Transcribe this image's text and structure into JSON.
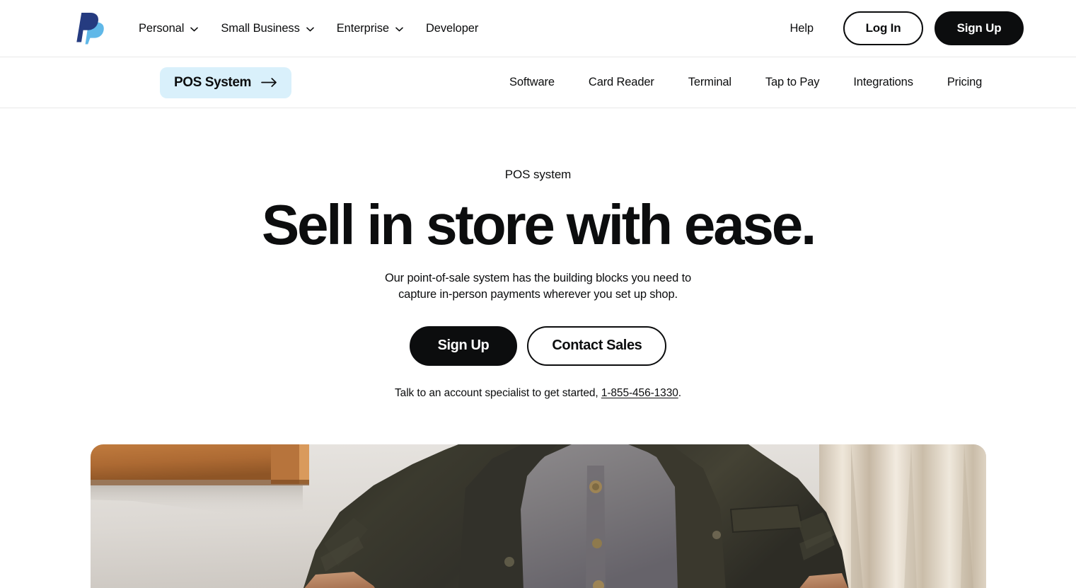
{
  "topnav": {
    "logo_icon": "paypal-logo-icon",
    "links": [
      {
        "label": "Personal",
        "has_chevron": true
      },
      {
        "label": "Small Business",
        "has_chevron": true
      },
      {
        "label": "Enterprise",
        "has_chevron": true
      },
      {
        "label": "Developer",
        "has_chevron": false
      }
    ],
    "help_label": "Help",
    "login_label": "Log In",
    "signup_label": "Sign Up"
  },
  "subnav": {
    "pill": {
      "label": "POS System",
      "arrow_icon": "arrow-right-icon",
      "background": "#d9f0fb"
    },
    "links": [
      {
        "label": "Software"
      },
      {
        "label": "Card Reader"
      },
      {
        "label": "Terminal"
      },
      {
        "label": "Tap to Pay"
      },
      {
        "label": "Integrations"
      },
      {
        "label": "Pricing"
      }
    ]
  },
  "hero": {
    "eyebrow": "POS system",
    "headline": "Sell in store with ease.",
    "subhead": "Our point-of-sale system has the building blocks you need to capture in-person payments wherever you set up shop.",
    "primary_cta": "Sign Up",
    "secondary_cta": "Contact Sales",
    "specialist_text_before": "Talk to an account specialist to get started, ",
    "phone_number": "1-855-456-1330",
    "specialist_text_after": ".",
    "image_alt": "Shop owner in dark olive jacket standing in store"
  },
  "colors": {
    "text": "#0c0d0e",
    "accent_pill": "#d9f0fb",
    "button_dark": "#0c0d0e",
    "border": "#e8e8e8",
    "logo_dark_blue": "#253b80",
    "logo_light_blue": "#60b8e8"
  }
}
